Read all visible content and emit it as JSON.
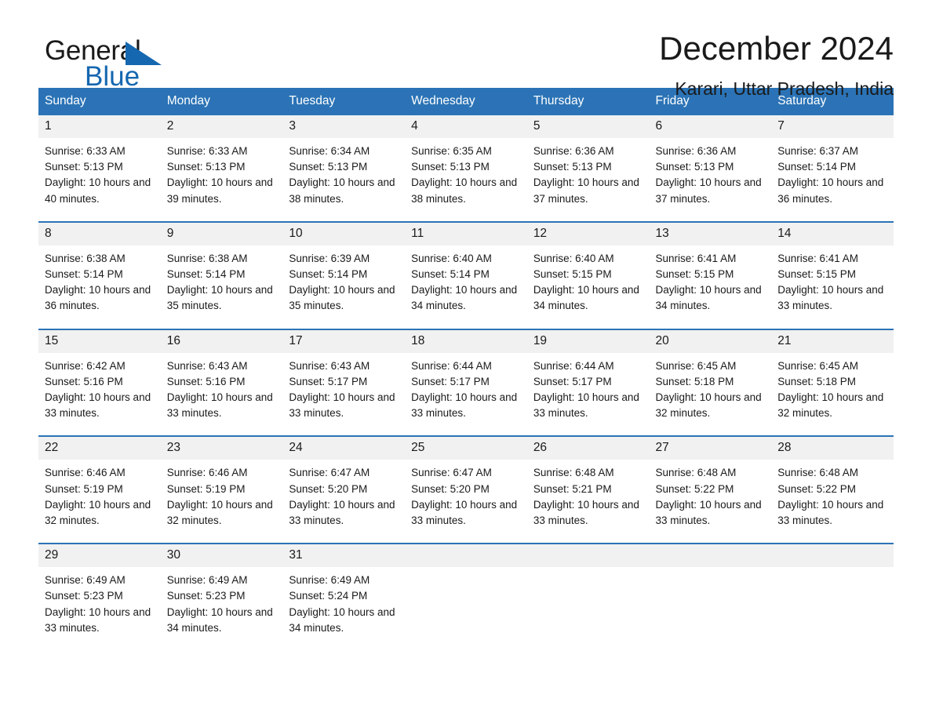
{
  "brand": {
    "name_part1": "General",
    "name_part2": "Blue"
  },
  "header": {
    "title": "December 2024",
    "location": "Karari, Uttar Pradesh, India"
  },
  "colors": {
    "header_blue": "#2b73b6",
    "logo_blue": "#1567b0",
    "daynum_band": "#f1f1f1",
    "text": "#1a1a1a"
  },
  "weekdays": [
    "Sunday",
    "Monday",
    "Tuesday",
    "Wednesday",
    "Thursday",
    "Friday",
    "Saturday"
  ],
  "labels": {
    "sunrise_prefix": "Sunrise:",
    "sunset_prefix": "Sunset:",
    "daylight_prefix": "Daylight:"
  },
  "weeks": [
    [
      {
        "day": "1",
        "sunrise": "Sunrise: 6:33 AM",
        "sunset": "Sunset: 5:13 PM",
        "daylight": "Daylight: 10 hours and 40 minutes."
      },
      {
        "day": "2",
        "sunrise": "Sunrise: 6:33 AM",
        "sunset": "Sunset: 5:13 PM",
        "daylight": "Daylight: 10 hours and 39 minutes."
      },
      {
        "day": "3",
        "sunrise": "Sunrise: 6:34 AM",
        "sunset": "Sunset: 5:13 PM",
        "daylight": "Daylight: 10 hours and 38 minutes."
      },
      {
        "day": "4",
        "sunrise": "Sunrise: 6:35 AM",
        "sunset": "Sunset: 5:13 PM",
        "daylight": "Daylight: 10 hours and 38 minutes."
      },
      {
        "day": "5",
        "sunrise": "Sunrise: 6:36 AM",
        "sunset": "Sunset: 5:13 PM",
        "daylight": "Daylight: 10 hours and 37 minutes."
      },
      {
        "day": "6",
        "sunrise": "Sunrise: 6:36 AM",
        "sunset": "Sunset: 5:13 PM",
        "daylight": "Daylight: 10 hours and 37 minutes."
      },
      {
        "day": "7",
        "sunrise": "Sunrise: 6:37 AM",
        "sunset": "Sunset: 5:14 PM",
        "daylight": "Daylight: 10 hours and 36 minutes."
      }
    ],
    [
      {
        "day": "8",
        "sunrise": "Sunrise: 6:38 AM",
        "sunset": "Sunset: 5:14 PM",
        "daylight": "Daylight: 10 hours and 36 minutes."
      },
      {
        "day": "9",
        "sunrise": "Sunrise: 6:38 AM",
        "sunset": "Sunset: 5:14 PM",
        "daylight": "Daylight: 10 hours and 35 minutes."
      },
      {
        "day": "10",
        "sunrise": "Sunrise: 6:39 AM",
        "sunset": "Sunset: 5:14 PM",
        "daylight": "Daylight: 10 hours and 35 minutes."
      },
      {
        "day": "11",
        "sunrise": "Sunrise: 6:40 AM",
        "sunset": "Sunset: 5:14 PM",
        "daylight": "Daylight: 10 hours and 34 minutes."
      },
      {
        "day": "12",
        "sunrise": "Sunrise: 6:40 AM",
        "sunset": "Sunset: 5:15 PM",
        "daylight": "Daylight: 10 hours and 34 minutes."
      },
      {
        "day": "13",
        "sunrise": "Sunrise: 6:41 AM",
        "sunset": "Sunset: 5:15 PM",
        "daylight": "Daylight: 10 hours and 34 minutes."
      },
      {
        "day": "14",
        "sunrise": "Sunrise: 6:41 AM",
        "sunset": "Sunset: 5:15 PM",
        "daylight": "Daylight: 10 hours and 33 minutes."
      }
    ],
    [
      {
        "day": "15",
        "sunrise": "Sunrise: 6:42 AM",
        "sunset": "Sunset: 5:16 PM",
        "daylight": "Daylight: 10 hours and 33 minutes."
      },
      {
        "day": "16",
        "sunrise": "Sunrise: 6:43 AM",
        "sunset": "Sunset: 5:16 PM",
        "daylight": "Daylight: 10 hours and 33 minutes."
      },
      {
        "day": "17",
        "sunrise": "Sunrise: 6:43 AM",
        "sunset": "Sunset: 5:17 PM",
        "daylight": "Daylight: 10 hours and 33 minutes."
      },
      {
        "day": "18",
        "sunrise": "Sunrise: 6:44 AM",
        "sunset": "Sunset: 5:17 PM",
        "daylight": "Daylight: 10 hours and 33 minutes."
      },
      {
        "day": "19",
        "sunrise": "Sunrise: 6:44 AM",
        "sunset": "Sunset: 5:17 PM",
        "daylight": "Daylight: 10 hours and 33 minutes."
      },
      {
        "day": "20",
        "sunrise": "Sunrise: 6:45 AM",
        "sunset": "Sunset: 5:18 PM",
        "daylight": "Daylight: 10 hours and 32 minutes."
      },
      {
        "day": "21",
        "sunrise": "Sunrise: 6:45 AM",
        "sunset": "Sunset: 5:18 PM",
        "daylight": "Daylight: 10 hours and 32 minutes."
      }
    ],
    [
      {
        "day": "22",
        "sunrise": "Sunrise: 6:46 AM",
        "sunset": "Sunset: 5:19 PM",
        "daylight": "Daylight: 10 hours and 32 minutes."
      },
      {
        "day": "23",
        "sunrise": "Sunrise: 6:46 AM",
        "sunset": "Sunset: 5:19 PM",
        "daylight": "Daylight: 10 hours and 32 minutes."
      },
      {
        "day": "24",
        "sunrise": "Sunrise: 6:47 AM",
        "sunset": "Sunset: 5:20 PM",
        "daylight": "Daylight: 10 hours and 33 minutes."
      },
      {
        "day": "25",
        "sunrise": "Sunrise: 6:47 AM",
        "sunset": "Sunset: 5:20 PM",
        "daylight": "Daylight: 10 hours and 33 minutes."
      },
      {
        "day": "26",
        "sunrise": "Sunrise: 6:48 AM",
        "sunset": "Sunset: 5:21 PM",
        "daylight": "Daylight: 10 hours and 33 minutes."
      },
      {
        "day": "27",
        "sunrise": "Sunrise: 6:48 AM",
        "sunset": "Sunset: 5:22 PM",
        "daylight": "Daylight: 10 hours and 33 minutes."
      },
      {
        "day": "28",
        "sunrise": "Sunrise: 6:48 AM",
        "sunset": "Sunset: 5:22 PM",
        "daylight": "Daylight: 10 hours and 33 minutes."
      }
    ],
    [
      {
        "day": "29",
        "sunrise": "Sunrise: 6:49 AM",
        "sunset": "Sunset: 5:23 PM",
        "daylight": "Daylight: 10 hours and 33 minutes."
      },
      {
        "day": "30",
        "sunrise": "Sunrise: 6:49 AM",
        "sunset": "Sunset: 5:23 PM",
        "daylight": "Daylight: 10 hours and 34 minutes."
      },
      {
        "day": "31",
        "sunrise": "Sunrise: 6:49 AM",
        "sunset": "Sunset: 5:24 PM",
        "daylight": "Daylight: 10 hours and 34 minutes."
      },
      {
        "day": "",
        "sunrise": "",
        "sunset": "",
        "daylight": ""
      },
      {
        "day": "",
        "sunrise": "",
        "sunset": "",
        "daylight": ""
      },
      {
        "day": "",
        "sunrise": "",
        "sunset": "",
        "daylight": ""
      },
      {
        "day": "",
        "sunrise": "",
        "sunset": "",
        "daylight": ""
      }
    ]
  ]
}
